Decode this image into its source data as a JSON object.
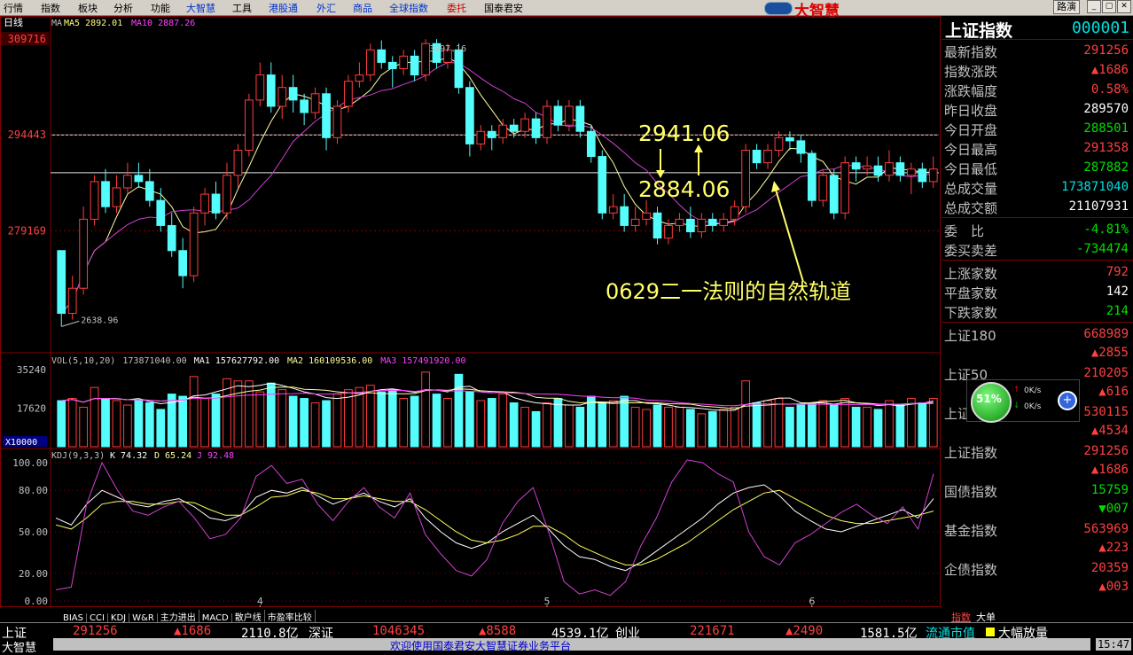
{
  "menu": [
    {
      "label": "行情",
      "color": "black"
    },
    {
      "label": "指数",
      "color": "black"
    },
    {
      "label": "板块",
      "color": "black"
    },
    {
      "label": "分析",
      "color": "black"
    },
    {
      "label": "功能",
      "color": "black"
    },
    {
      "label": "大智慧",
      "color": "blue"
    },
    {
      "label": "工具",
      "color": "black"
    },
    {
      "label": "港股通",
      "color": "blue"
    },
    {
      "label": "外汇",
      "color": "blue"
    },
    {
      "label": "商品",
      "color": "blue"
    },
    {
      "label": "全球指数",
      "color": "blue"
    },
    {
      "label": "委托",
      "color": "red"
    },
    {
      "label": "国泰君安",
      "color": "black"
    }
  ],
  "app": {
    "logo": "大智慧",
    "back_button": "路演",
    "win_buttons": [
      "_",
      "▢",
      "✕"
    ]
  },
  "chart_data": {
    "type": "candlestick",
    "period_label": "日线",
    "ma_header": {
      "ma": "MA",
      "ma5": "MA5 2892.01",
      "ma10": "MA10 2887.26"
    },
    "price_axis": [
      "309716",
      "294443",
      "279169"
    ],
    "high_label": "3097.16",
    "low_label": "2638.96",
    "hlines": [
      2944.43,
      2884.06
    ],
    "annotations": {
      "a1": "2941.06",
      "a2": "2884.06",
      "a3": "0629二一法则的自然轨道"
    },
    "date_ticks": [
      "4",
      "5",
      "6"
    ],
    "vol": {
      "header_prefix": "VOL(5,10,20)",
      "vol": "173871040.00",
      "ma1": "MA1 157627792.00",
      "ma2": "MA2 160109536.00",
      "ma3": "MA3 157491920.00",
      "axis": [
        "35240",
        "17620"
      ],
      "unit": "X10000"
    },
    "kdj": {
      "header": "KDJ(9,3,3)",
      "k": "K 74.32",
      "d": "D 65.24",
      "j": "J 92.48",
      "axis": [
        "100.00",
        "80.00",
        "50.00",
        "20.00",
        "0.00"
      ]
    },
    "candles": [
      [
        2760,
        2660,
        2760,
        2639
      ],
      [
        2660,
        2700,
        2720,
        2650
      ],
      [
        2700,
        2810,
        2830,
        2690
      ],
      [
        2810,
        2870,
        2880,
        2800
      ],
      [
        2870,
        2830,
        2890,
        2820
      ],
      [
        2830,
        2860,
        2880,
        2820
      ],
      [
        2860,
        2880,
        2900,
        2850
      ],
      [
        2880,
        2870,
        2900,
        2860
      ],
      [
        2870,
        2840,
        2890,
        2830
      ],
      [
        2840,
        2800,
        2860,
        2790
      ],
      [
        2800,
        2760,
        2820,
        2750
      ],
      [
        2760,
        2720,
        2780,
        2700
      ],
      [
        2720,
        2820,
        2830,
        2710
      ],
      [
        2820,
        2850,
        2860,
        2800
      ],
      [
        2850,
        2820,
        2870,
        2810
      ],
      [
        2820,
        2880,
        2900,
        2810
      ],
      [
        2880,
        2920,
        2930,
        2860
      ],
      [
        2920,
        3000,
        3010,
        2910
      ],
      [
        3000,
        3040,
        3060,
        2990
      ],
      [
        3040,
        2990,
        3060,
        2980
      ],
      [
        2990,
        3020,
        3040,
        2970
      ],
      [
        3020,
        3000,
        3040,
        2980
      ],
      [
        3000,
        2980,
        3010,
        2960
      ],
      [
        2980,
        3010,
        3020,
        2970
      ],
      [
        3010,
        2940,
        3020,
        2920
      ],
      [
        2940,
        2990,
        3000,
        2930
      ],
      [
        2990,
        3030,
        3040,
        2980
      ],
      [
        3030,
        3040,
        3060,
        3020
      ],
      [
        3040,
        3080,
        3090,
        3030
      ],
      [
        3080,
        3060,
        3095,
        3050
      ],
      [
        3060,
        3050,
        3070,
        3020
      ],
      [
        3050,
        3070,
        3080,
        3040
      ],
      [
        3070,
        3040,
        3080,
        3030
      ],
      [
        3040,
        3090,
        3097,
        3030
      ],
      [
        3090,
        3060,
        3097,
        3050
      ],
      [
        3060,
        3080,
        3090,
        3050
      ],
      [
        3080,
        3020,
        3090,
        3010
      ],
      [
        3020,
        2930,
        3030,
        2910
      ],
      [
        2930,
        2950,
        2960,
        2920
      ],
      [
        2950,
        2940,
        2960,
        2920
      ],
      [
        2940,
        2960,
        2970,
        2930
      ],
      [
        2960,
        2950,
        2970,
        2940
      ],
      [
        2950,
        2970,
        2980,
        2940
      ],
      [
        2970,
        2940,
        2980,
        2930
      ],
      [
        2940,
        2990,
        3000,
        2930
      ],
      [
        2990,
        2960,
        3000,
        2950
      ],
      [
        2960,
        2990,
        3000,
        2950
      ],
      [
        2990,
        2950,
        3000,
        2940
      ],
      [
        2950,
        2910,
        2960,
        2900
      ],
      [
        2910,
        2820,
        2920,
        2810
      ],
      [
        2820,
        2830,
        2850,
        2810
      ],
      [
        2830,
        2800,
        2850,
        2790
      ],
      [
        2800,
        2810,
        2830,
        2790
      ],
      [
        2810,
        2820,
        2840,
        2800
      ],
      [
        2820,
        2780,
        2830,
        2770
      ],
      [
        2780,
        2800,
        2810,
        2770
      ],
      [
        2800,
        2810,
        2820,
        2790
      ],
      [
        2810,
        2790,
        2830,
        2780
      ],
      [
        2790,
        2810,
        2820,
        2780
      ],
      [
        2810,
        2800,
        2820,
        2790
      ],
      [
        2800,
        2810,
        2820,
        2790
      ],
      [
        2810,
        2830,
        2840,
        2800
      ],
      [
        2830,
        2920,
        2930,
        2820
      ],
      [
        2920,
        2900,
        2930,
        2890
      ],
      [
        2900,
        2920,
        2930,
        2890
      ],
      [
        2920,
        2940,
        2950,
        2910
      ],
      [
        2940,
        2935,
        2950,
        2920
      ],
      [
        2935,
        2915,
        2945,
        2900
      ],
      [
        2915,
        2840,
        2920,
        2830
      ],
      [
        2840,
        2880,
        2890,
        2830
      ],
      [
        2880,
        2820,
        2890,
        2810
      ],
      [
        2820,
        2900,
        2910,
        2810
      ],
      [
        2900,
        2890,
        2910,
        2870
      ],
      [
        2890,
        2895,
        2910,
        2880
      ],
      [
        2895,
        2880,
        2910,
        2870
      ],
      [
        2880,
        2900,
        2920,
        2870
      ],
      [
        2900,
        2880,
        2910,
        2870
      ],
      [
        2880,
        2890,
        2900,
        2850
      ],
      [
        2890,
        2870,
        2900,
        2860
      ],
      [
        2870,
        2890,
        2910,
        2860
      ]
    ],
    "volumes": [
      21,
      22,
      18,
      27,
      22,
      21,
      19,
      21,
      20,
      17,
      24,
      23,
      32,
      22,
      24,
      31,
      30,
      30,
      25,
      29,
      26,
      23,
      22,
      20,
      21,
      24,
      26,
      27,
      28,
      25,
      26,
      22,
      23,
      34,
      24,
      22,
      33,
      25,
      21,
      22,
      24,
      20,
      18,
      16,
      20,
      22,
      19,
      18,
      23,
      20,
      21,
      23,
      18,
      17,
      19,
      18,
      18,
      17,
      15,
      16,
      17,
      18,
      30,
      20,
      21,
      22,
      18,
      19,
      20,
      21,
      19,
      22,
      18,
      18,
      17,
      21,
      19,
      22,
      20,
      22
    ],
    "k": [
      60,
      55,
      70,
      80,
      75,
      70,
      68,
      72,
      74,
      68,
      60,
      58,
      62,
      75,
      80,
      78,
      82,
      76,
      70,
      74,
      78,
      72,
      68,
      74,
      60,
      50,
      42,
      38,
      42,
      50,
      56,
      62,
      52,
      40,
      32,
      30,
      25,
      22,
      28,
      36,
      44,
      52,
      60,
      70,
      78,
      82,
      84,
      76,
      65,
      58,
      52,
      50,
      54,
      58,
      62,
      66,
      60,
      74
    ],
    "d": [
      55,
      52,
      60,
      70,
      72,
      72,
      70,
      70,
      72,
      71,
      66,
      62,
      62,
      68,
      75,
      76,
      80,
      78,
      74,
      74,
      76,
      74,
      72,
      72,
      66,
      58,
      50,
      44,
      42,
      44,
      48,
      54,
      54,
      48,
      40,
      35,
      30,
      26,
      26,
      30,
      36,
      42,
      50,
      58,
      66,
      72,
      78,
      80,
      74,
      68,
      62,
      58,
      56,
      56,
      58,
      60,
      62,
      65
    ],
    "j": [
      8,
      10,
      70,
      100,
      80,
      65,
      62,
      68,
      72,
      60,
      45,
      48,
      60,
      90,
      98,
      85,
      88,
      70,
      58,
      72,
      82,
      68,
      60,
      78,
      48,
      34,
      22,
      18,
      30,
      56,
      72,
      82,
      50,
      14,
      5,
      8,
      4,
      14,
      40,
      60,
      86,
      102,
      100,
      92,
      86,
      50,
      32,
      26,
      42,
      48,
      56,
      64,
      70,
      62,
      56,
      68,
      52,
      92
    ]
  },
  "rpanel": {
    "title": "上证指数",
    "code": "000001",
    "rows1": [
      {
        "label": "最新指数",
        "value": "291256",
        "color": "#ff4040"
      },
      {
        "label": "指数涨跌",
        "value": "▲1686",
        "color": "#ff4040"
      },
      {
        "label": "涨跌幅度",
        "value": "0.58%",
        "color": "#ff4040"
      },
      {
        "label": "昨日收盘",
        "value": "289570",
        "color": "#ffffff"
      },
      {
        "label": "今日开盘",
        "value": "288501",
        "color": "#00e000"
      },
      {
        "label": "今日最高",
        "value": "291358",
        "color": "#ff4040"
      },
      {
        "label": "今日最低",
        "value": "287882",
        "color": "#00e000"
      },
      {
        "label": "总成交量",
        "value": "173871040",
        "color": "#00e0e0"
      },
      {
        "label": "总成交额",
        "value": "21107931",
        "color": "#ffffff"
      }
    ],
    "rows2": [
      {
        "label": "委　比",
        "value": "-4.81%",
        "color": "#00e000"
      },
      {
        "label": "委买卖差",
        "value": "-734474",
        "color": "#00e000"
      }
    ],
    "rows3": [
      {
        "label": "上涨家数",
        "value": "792",
        "color": "#ff4040"
      },
      {
        "label": "平盘家数",
        "value": "142",
        "color": "#ffffff"
      },
      {
        "label": "下跌家数",
        "value": "214",
        "color": "#00e000"
      }
    ],
    "indices": [
      {
        "label": "上证180",
        "value": "668989",
        "change": "▲2855"
      },
      {
        "label": "上证50",
        "value": "210205",
        "change": "▲616"
      },
      {
        "label": "上证",
        "value": "530115",
        "change": "▲4534"
      },
      {
        "label": "上证指数",
        "value": "291256",
        "change": "▲1686"
      },
      {
        "label": "国债指数",
        "value": "15759",
        "change": "▼007"
      },
      {
        "label": "基金指数",
        "value": "563969",
        "change": "▲223"
      },
      {
        "label": "企债指数",
        "value": "20359",
        "change": "▲003"
      }
    ]
  },
  "floatw": {
    "pct": "51%",
    "up": "0K/s",
    "down": "0K/s",
    "plus": "+"
  },
  "tabs_left": [
    "BIAS",
    "CCI",
    "KDJ",
    "W&R",
    "主力进出",
    "MACD",
    "散户线",
    "市盈率比较"
  ],
  "tabs_right": [
    "指数",
    "大单"
  ],
  "status": {
    "sh_label": "上证",
    "sh_val": "291256",
    "sh_chg": "▲1686",
    "sh_amt": "2110.8亿",
    "sz_label": "深证",
    "sz_val": "1046345",
    "sz_chg": "▲8588",
    "sz_amt": "4539.1亿",
    "cy_label": "创业",
    "cy_val": "221671",
    "cy_chg": "▲2490",
    "cy_amt": "1581.5亿",
    "ltsz": "流通市值",
    "dfzd": "大幅放量",
    "time": "15:47",
    "bottom_left": "大智慧",
    "ticker": "欢迎使用国泰君安大智慧证券业务平台"
  }
}
